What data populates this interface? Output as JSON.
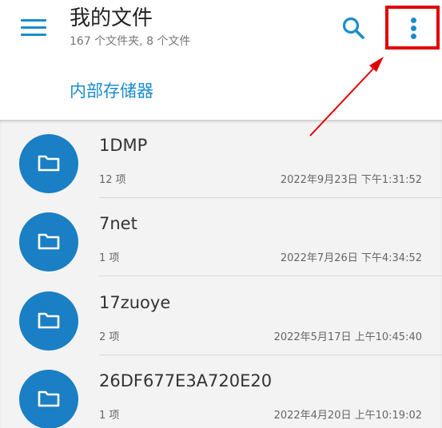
{
  "header": {
    "title": "我的文件",
    "subtitle": "167 个文件夹, 8 个文件",
    "storage_link": "内部存储器"
  },
  "icons": {
    "menu": "menu-icon",
    "search": "search-icon",
    "overflow": "more-vert-icon",
    "folder": "folder-icon"
  },
  "colors": {
    "accent": "#1a8ccd",
    "folder_circle": "#1a7fc4",
    "highlight": "#e10000"
  },
  "folders": [
    {
      "name": "1DMP",
      "count": "12 项",
      "date": "2022年9月23日 下午1:31:52"
    },
    {
      "name": "7net",
      "count": "1 项",
      "date": "2022年7月26日 下午4:34:52"
    },
    {
      "name": "17zuoye",
      "count": "2 项",
      "date": "2022年5月17日 上午10:45:40"
    },
    {
      "name": "26DF677E3A720E20",
      "count": "1 项",
      "date": "2022年4月20日 上午10:19:02"
    }
  ]
}
